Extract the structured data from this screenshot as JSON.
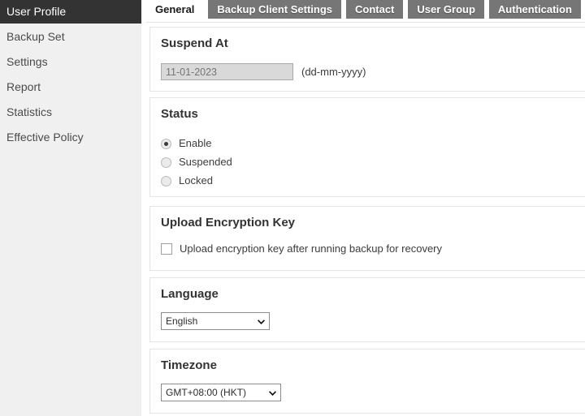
{
  "sidebar": {
    "items": [
      {
        "label": "User Profile",
        "active": true
      },
      {
        "label": "Backup Set",
        "active": false
      },
      {
        "label": "Settings",
        "active": false
      },
      {
        "label": "Report",
        "active": false
      },
      {
        "label": "Statistics",
        "active": false
      },
      {
        "label": "Effective Policy",
        "active": false
      }
    ]
  },
  "tabs": [
    {
      "label": "General",
      "active": true
    },
    {
      "label": "Backup Client Settings",
      "active": false
    },
    {
      "label": "Contact",
      "active": false
    },
    {
      "label": "User Group",
      "active": false
    },
    {
      "label": "Authentication",
      "active": false
    }
  ],
  "sections": {
    "suspend": {
      "title": "Suspend At",
      "date_value": "11-01-2023",
      "date_placeholder": "11-01-2023",
      "format_hint": "(dd-mm-yyyy)"
    },
    "status": {
      "title": "Status",
      "options": [
        {
          "label": "Enable",
          "selected": true
        },
        {
          "label": "Suspended",
          "selected": false
        },
        {
          "label": "Locked",
          "selected": false
        }
      ]
    },
    "upload_encryption_key": {
      "title": "Upload Encryption Key",
      "checkbox_label": "Upload encryption key after running backup for recovery",
      "checked": false
    },
    "language": {
      "title": "Language",
      "selected": "English"
    },
    "timezone": {
      "title": "Timezone",
      "selected": "GMT+08:00 (HKT)"
    }
  },
  "colors": {
    "sidebar_bg": "#f0f0f0",
    "sidebar_active_bg": "#333333",
    "tab_inactive_bg": "#767676",
    "panel_border": "#e4e4e4",
    "text": "#3c3c3c"
  }
}
